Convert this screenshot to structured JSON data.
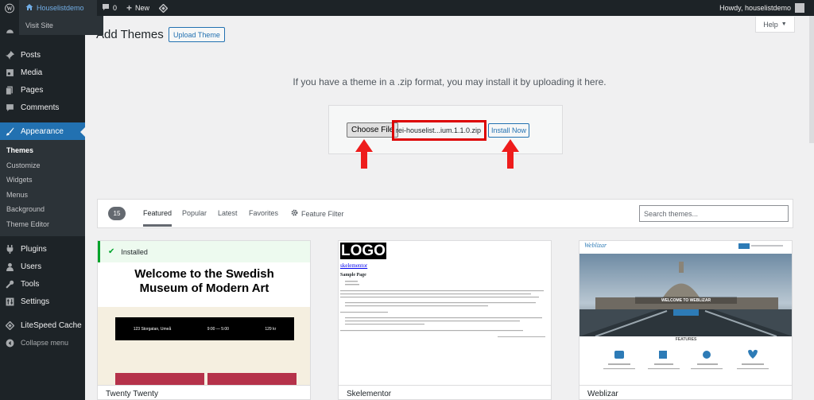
{
  "admin_bar": {
    "site_name": "Houselistdemo",
    "comments_count": "0",
    "new_label": "New",
    "howdy": "Howdy, houselistdemo",
    "flyout_item": "Visit Site"
  },
  "sidebar": {
    "items": [
      {
        "label": "Posts",
        "icon": "pin-icon"
      },
      {
        "label": "Media",
        "icon": "media-icon"
      },
      {
        "label": "Pages",
        "icon": "pages-icon"
      },
      {
        "label": "Comments",
        "icon": "comments-icon"
      },
      {
        "label": "Appearance",
        "icon": "brush-icon"
      }
    ],
    "submenu": [
      "Themes",
      "Customize",
      "Widgets",
      "Menus",
      "Background",
      "Theme Editor"
    ],
    "items_after": [
      {
        "label": "Plugins",
        "icon": "plugin-icon"
      },
      {
        "label": "Users",
        "icon": "users-icon"
      },
      {
        "label": "Tools",
        "icon": "tools-icon"
      },
      {
        "label": "Settings",
        "icon": "settings-icon"
      },
      {
        "label": "LiteSpeed Cache",
        "icon": "litespeed-icon"
      },
      {
        "label": "Collapse menu",
        "icon": "collapse-icon"
      }
    ]
  },
  "page": {
    "title": "Add Themes",
    "upload_button": "Upload Theme",
    "help_label": "Help",
    "upload_help": "If you have a theme in a .zip format, you may install it by uploading it here.",
    "choose_file": "Choose File",
    "file_name": "rei-houselist...ium.1.1.0.zip",
    "install_now": "Install Now"
  },
  "filter": {
    "count": "15",
    "tabs": [
      "Featured",
      "Popular",
      "Latest",
      "Favorites"
    ],
    "feature_filter": "Feature Filter",
    "search_placeholder": "Search themes..."
  },
  "themes": [
    {
      "name": "Twenty Twenty",
      "installed_label": "Installed",
      "headline": "Welcome to the Swedish Museum of Modern Art",
      "address": "123 Storgatan, Umeå",
      "hours": "9:00 — 5:00",
      "price": "129 kr"
    },
    {
      "name": "Skelementor",
      "logo": "LOGO",
      "site_title": "skelementor",
      "page_title": "Sample Page"
    },
    {
      "name": "Weblizar",
      "logo": "Weblizar",
      "hero": "WELCOME TO WEBLIZAR",
      "section": "FEATURES"
    }
  ],
  "colors": {
    "admin_bar": "#1d2327",
    "sidebar": "#1d2327",
    "accent": "#2271b1",
    "highlight_box": "#dd0000",
    "arrow": "#ee1c1c"
  }
}
